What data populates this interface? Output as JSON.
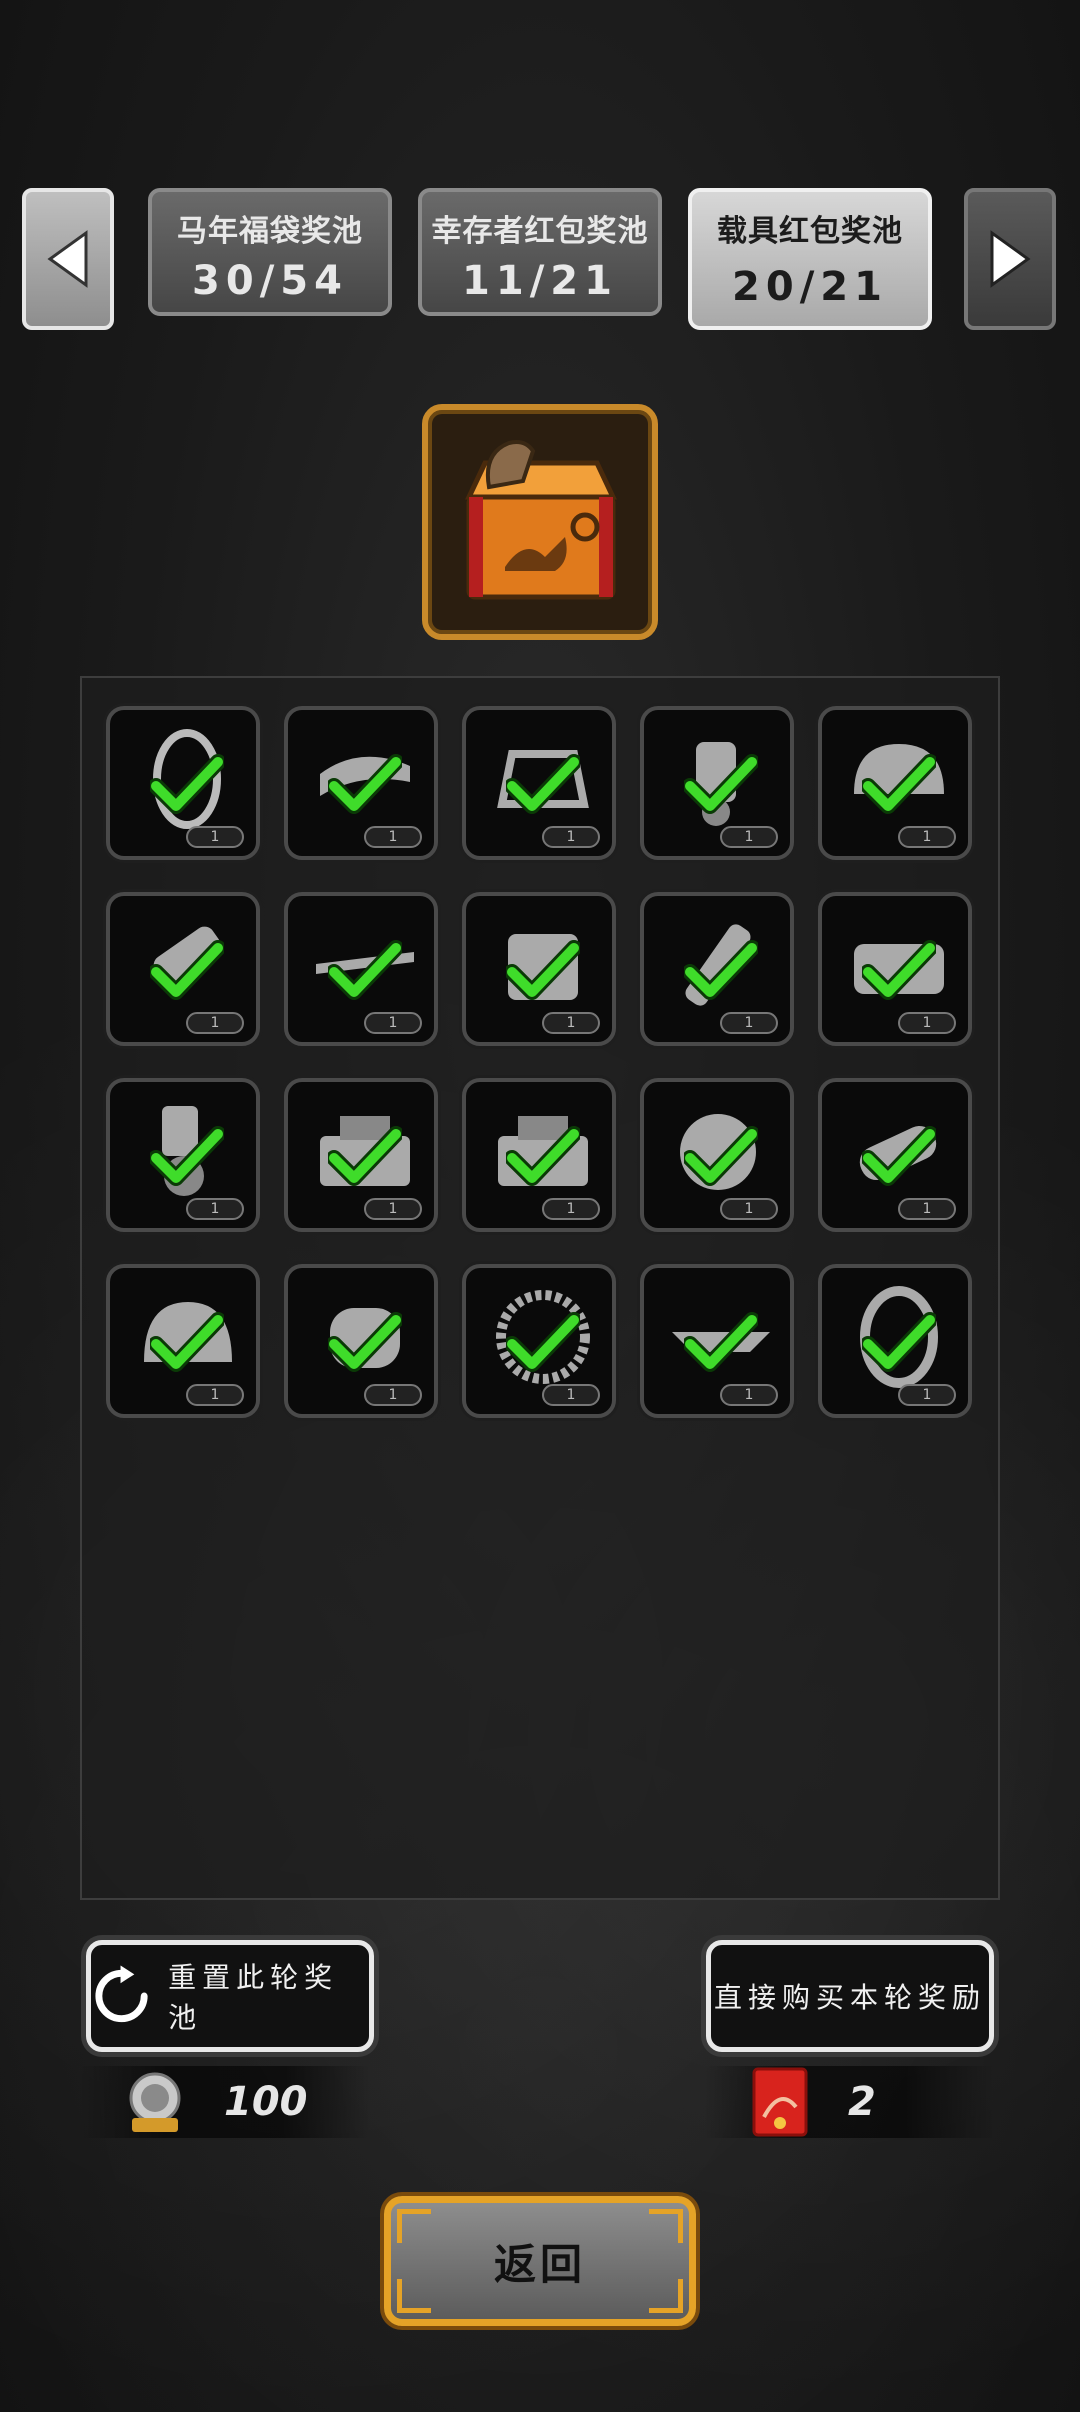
{
  "tabs": [
    {
      "title": "马年福袋奖池",
      "count": "30/54",
      "active": false
    },
    {
      "title": "幸存者红包奖池",
      "count": "11/21",
      "active": false
    },
    {
      "title": "载具红包奖池",
      "count": "20/21",
      "active": true
    }
  ],
  "nav": {
    "prev_icon": "arrow-left-icon",
    "next_icon": "arrow-right-icon"
  },
  "chest": {
    "icon": "horse-treasure-chest-icon"
  },
  "items": [
    {
      "icon": "tire-icon",
      "claimed": true,
      "qty": "1"
    },
    {
      "icon": "exhaust-pipe-icon",
      "claimed": true,
      "qty": "1"
    },
    {
      "icon": "roll-cage-icon",
      "claimed": true,
      "qty": "1"
    },
    {
      "icon": "piston-icon",
      "claimed": true,
      "qty": "1"
    },
    {
      "icon": "car-hood-icon",
      "claimed": true,
      "qty": "1"
    },
    {
      "icon": "shock-absorber-icon",
      "claimed": true,
      "qty": "1"
    },
    {
      "icon": "spoiler-icon",
      "claimed": true,
      "qty": "1"
    },
    {
      "icon": "engine-block-icon",
      "claimed": true,
      "qty": "1"
    },
    {
      "icon": "spark-plug-icon",
      "claimed": true,
      "qty": "1"
    },
    {
      "icon": "v8-engine-icon",
      "claimed": true,
      "qty": "1"
    },
    {
      "icon": "gear-lever-icon",
      "claimed": true,
      "qty": "1"
    },
    {
      "icon": "toolbox-icon",
      "claimed": true,
      "qty": "1"
    },
    {
      "icon": "toolbox-icon",
      "claimed": true,
      "qty": "1"
    },
    {
      "icon": "turbo-engine-icon",
      "claimed": true,
      "qty": "1"
    },
    {
      "icon": "axle-icon",
      "claimed": true,
      "qty": "1"
    },
    {
      "icon": "transmission-icon",
      "claimed": true,
      "qty": "1"
    },
    {
      "icon": "fuel-tank-icon",
      "claimed": true,
      "qty": "1"
    },
    {
      "icon": "snow-chain-tire-icon",
      "claimed": true,
      "qty": "1"
    },
    {
      "icon": "chassis-frame-icon",
      "claimed": true,
      "qty": "1"
    },
    {
      "icon": "wheel-rim-icon",
      "claimed": true,
      "qty": "1"
    }
  ],
  "actions": {
    "reset_label": "重置此轮奖池",
    "buy_label": "直接购买本轮奖励"
  },
  "stats": {
    "luck_value": "100",
    "luck_icon": "luck-coin-icon",
    "envelope_count": "2",
    "envelope_icon": "red-envelope-icon"
  },
  "back_label": "返回",
  "colors": {
    "accent_gold": "#e5a327",
    "check_green": "#3fdc2a"
  }
}
